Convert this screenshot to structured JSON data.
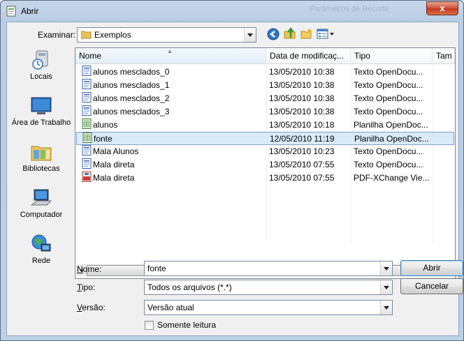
{
  "window": {
    "title": "Abrir",
    "ghost_title": "Parâmetros de Recorte",
    "close_label": "x"
  },
  "look_in": {
    "label": "Examinar:",
    "value": "Exemplos"
  },
  "places": [
    {
      "name": "places-locais",
      "label": "Locais"
    },
    {
      "name": "places-area-de-trabalho",
      "label": "Área de Trabalho"
    },
    {
      "name": "places-bibliotecas",
      "label": "Bibliotecas"
    },
    {
      "name": "places-computador",
      "label": "Computador"
    },
    {
      "name": "places-rede",
      "label": "Rede"
    }
  ],
  "columns": {
    "name": "Nome",
    "date": "Data de modificaç...",
    "type": "Tipo",
    "size": "Tam"
  },
  "files": [
    {
      "name": "alunos mesclados_0",
      "date": "13/05/2010 10:38",
      "type": "Texto OpenDocu...",
      "icon": "text-doc-icon"
    },
    {
      "name": "alunos mesclados_1",
      "date": "13/05/2010 10:38",
      "type": "Texto OpenDocu...",
      "icon": "text-doc-icon"
    },
    {
      "name": "alunos mesclados_2",
      "date": "13/05/2010 10:38",
      "type": "Texto OpenDocu...",
      "icon": "text-doc-icon"
    },
    {
      "name": "alunos mesclados_3",
      "date": "13/05/2010 10:38",
      "type": "Texto OpenDocu...",
      "icon": "text-doc-icon"
    },
    {
      "name": "alunos",
      "date": "13/05/2010 10:18",
      "type": "Planilha OpenDoc...",
      "icon": "spreadsheet-icon"
    },
    {
      "name": "fonte",
      "date": "12/05/2010 11:19",
      "type": "Planilha OpenDoc...",
      "icon": "spreadsheet-icon",
      "selected": true
    },
    {
      "name": "Mala Alunos",
      "date": "13/05/2010 10:23",
      "type": "Texto OpenDocu...",
      "icon": "text-doc-icon"
    },
    {
      "name": "Mala direta",
      "date": "13/05/2010 07:55",
      "type": "Texto OpenDocu...",
      "icon": "text-doc-icon"
    },
    {
      "name": "Mala direta",
      "date": "13/05/2010 07:55",
      "type": "PDF-XChange Vie...",
      "icon": "pdf-icon"
    }
  ],
  "form": {
    "name_label": "Nome:",
    "name_value": "fonte",
    "type_label": "Tipo:",
    "type_value": "Todos os arquivos (*.*)",
    "version_label": "Versão:",
    "version_value": "Versão atual",
    "readonly_label": "Somente leitura"
  },
  "buttons": {
    "open": "Abrir",
    "cancel": "Cancelar"
  },
  "colors": {
    "selection": "#d9ebf9",
    "selection_border": "#7da2ce",
    "title_gradient": "#b9cde6"
  }
}
